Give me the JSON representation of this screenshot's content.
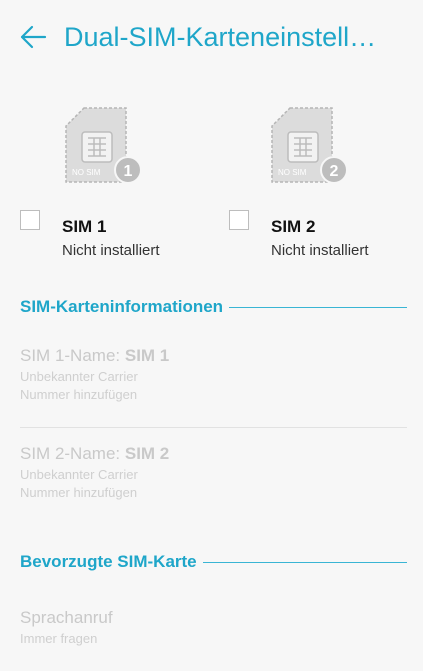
{
  "header": {
    "title": "Dual-SIM-Karteneinstell…"
  },
  "sims": [
    {
      "badge_text": "NO SIM",
      "number": "1",
      "label": "SIM 1",
      "status": "Nicht installiert"
    },
    {
      "badge_text": "NO SIM",
      "number": "2",
      "label": "SIM 2",
      "status": "Nicht installiert"
    }
  ],
  "sections": {
    "sim_info": "SIM-Karteninformationen",
    "preferred": "Bevorzugte SIM-Karte"
  },
  "sim_info_items": [
    {
      "name_prefix": "SIM 1-Name: ",
      "name_value": "SIM 1",
      "carrier": "Unbekannter Carrier",
      "number_action": "Nummer hinzufügen"
    },
    {
      "name_prefix": "SIM 2-Name: ",
      "name_value": "SIM 2",
      "carrier": "Unbekannter Carrier",
      "number_action": "Nummer hinzufügen"
    }
  ],
  "preferred_items": [
    {
      "title": "Sprachanruf",
      "value": "Immer fragen"
    }
  ],
  "colors": {
    "accent": "#1fa6c9",
    "disabled_text": "#c9c9c9"
  },
  "icons": {
    "back": "arrow-left-icon",
    "sim": "sim-card-icon"
  }
}
